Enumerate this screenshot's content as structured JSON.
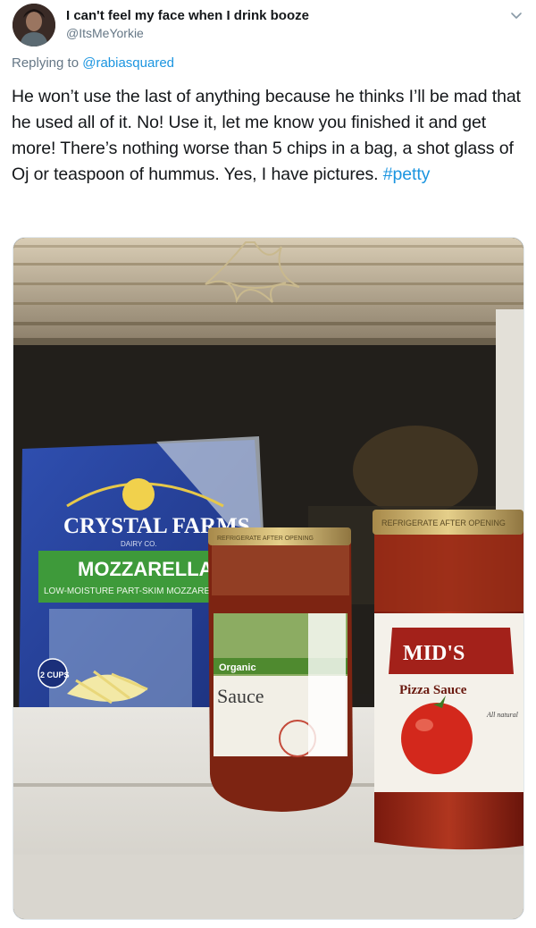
{
  "tweet": {
    "display_name": "I can't feel my face when I drink booze",
    "handle": "@ItsMeYorkie",
    "reply_prefix": "Replying to",
    "reply_to": "@rabiasquared",
    "text_before_tag": "He won’t use the last of anything because he thinks I’ll be mad that he used all of it. No! Use it, let me know you finished it and get more! There’s nothing worse than 5 chips in a bag, a shot glass of Oj or teaspoon of hummus. Yes, I have pictures. ",
    "hashtag": "#petty"
  },
  "icons": {
    "menu": "chevron-down-icon",
    "avatar": "user-avatar"
  },
  "colors": {
    "link": "#1b95e0",
    "muted": "#657786",
    "text": "#14171a"
  },
  "photo": {
    "cheese_brand": "CRYSTAL FARMS",
    "cheese_subbrand": "DAIRY CO.",
    "cheese_type": "MOZZARELLA",
    "cheese_desc": "LOW-MOISTURE PART-SKIM MOZZARELLA CHEESE",
    "cheese_cups": "2 CUPS",
    "jar1_lid": "REFRIGERATE AFTER OPENING",
    "jar1_label": "Sauce",
    "jar1_sublabel": "Organic",
    "jar2_lid": "REFRIGERATE AFTER OPENING",
    "jar2_brand": "MID'S",
    "jar2_label": "Pizza Sauce",
    "jar2_tag": "All natural"
  }
}
